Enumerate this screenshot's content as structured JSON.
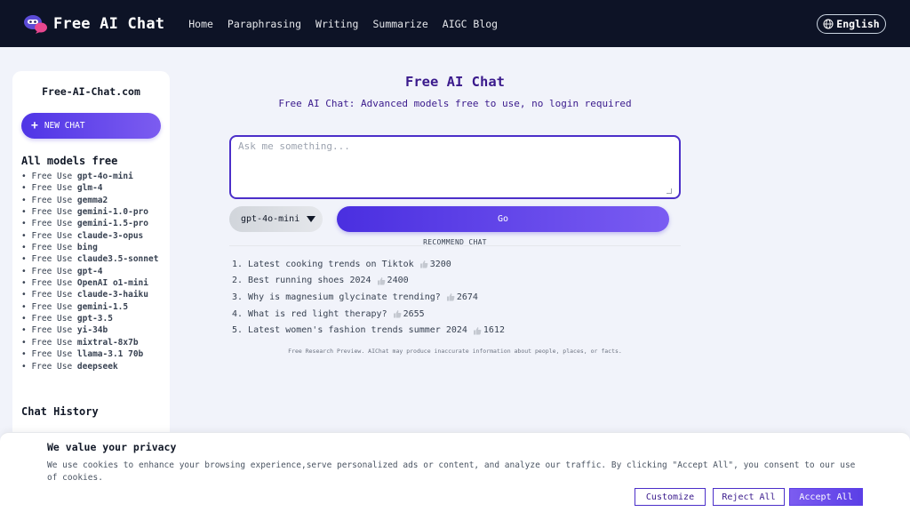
{
  "header": {
    "logo_text": "Free AI Chat",
    "nav": [
      "Home",
      "Paraphrasing",
      "Writing",
      "Summarize",
      "AIGC Blog"
    ],
    "language": "English"
  },
  "sidebar": {
    "site_name": "Free-AI-Chat.com",
    "new_chat": "NEW CHAT",
    "models_title": "All models free",
    "model_prefix": "• Free Use ",
    "models": [
      "gpt-4o-mini",
      "glm-4",
      "gemma2",
      "gemini-1.0-pro",
      "gemini-1.5-pro",
      "claude-3-opus",
      "bing",
      "claude3.5-sonnet",
      "gpt-4",
      "OpenAI o1-mini",
      "claude-3-haiku",
      "gemini-1.5",
      "gpt-3.5",
      "yi-34b",
      "mixtral-8x7b",
      "llama-3.1 70b",
      "deepseek"
    ],
    "history_title": "Chat History"
  },
  "main": {
    "title": "Free AI Chat",
    "subtitle": "Free AI Chat: Advanced models free to use, no login required",
    "input_placeholder": "Ask me something...",
    "selected_model": "gpt-4o-mini",
    "go_label": "Go",
    "recommend_label": "RECOMMEND CHAT",
    "recommendations": [
      {
        "text": "1. Latest cooking trends on Tiktok",
        "likes": "3200"
      },
      {
        "text": "2. Best running shoes 2024",
        "likes": "2400"
      },
      {
        "text": "3. Why is magnesium glycinate trending?",
        "likes": "2674"
      },
      {
        "text": "4. What is red light therapy?",
        "likes": "2655"
      },
      {
        "text": "5. Latest women's fashion trends summer 2024",
        "likes": "1612"
      }
    ],
    "disclaimer": "Free Research Preview. AIChat may produce inaccurate information about people, places, or facts."
  },
  "cookie": {
    "title": "We value your privacy",
    "text": "We use cookies to enhance your browsing experience,serve personalized ads or content, and analyze our traffic. By clicking \"Accept All\", you consent to our use of cookies.",
    "customize": "Customize",
    "reject": "Reject All",
    "accept": "Accept All"
  },
  "colors": {
    "header_bg": "#0d1326",
    "accent": "#4b2fc9",
    "title": "#3a1a8c"
  }
}
